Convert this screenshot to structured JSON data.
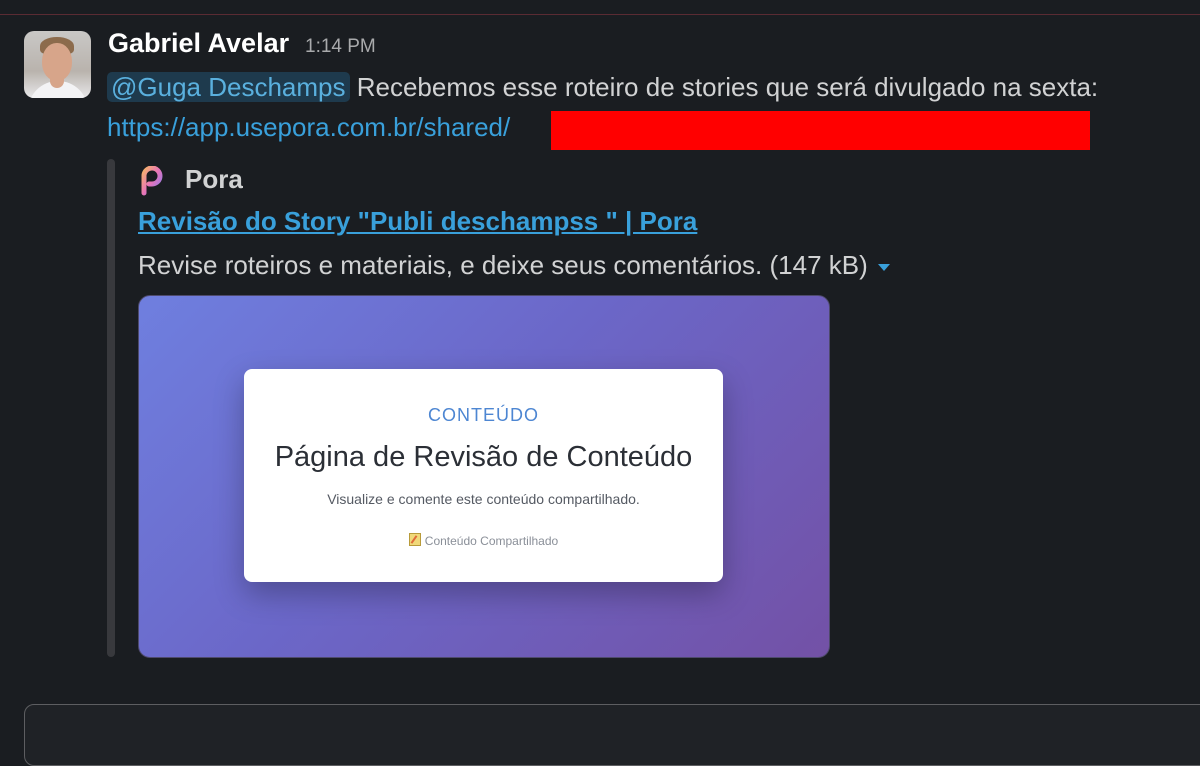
{
  "message": {
    "author": "Gabriel Avelar",
    "time": "1:14 PM",
    "mention": "@Guga Deschamps",
    "text": " Recebemos esse roteiro de stories que será divulgado na sexta:",
    "url": "https://app.usepora.com.br/shared/"
  },
  "attachment": {
    "site_name": "Pora",
    "title": "Revisão do Story \"Publi deschampss \" | Pora",
    "description": "Revise roteiros e materiais, e deixe seus comentários. (147 kB)",
    "preview": {
      "eyebrow": "CONTEÚDO",
      "heading": "Página de Revisão de Conteúdo",
      "subtitle": "Visualize e comente este conteúdo compartilhado.",
      "badge": "Conteúdo Compartilhado"
    }
  },
  "colors": {
    "background": "#1a1d21",
    "link": "#39a0db",
    "redaction": "#ff0000"
  }
}
